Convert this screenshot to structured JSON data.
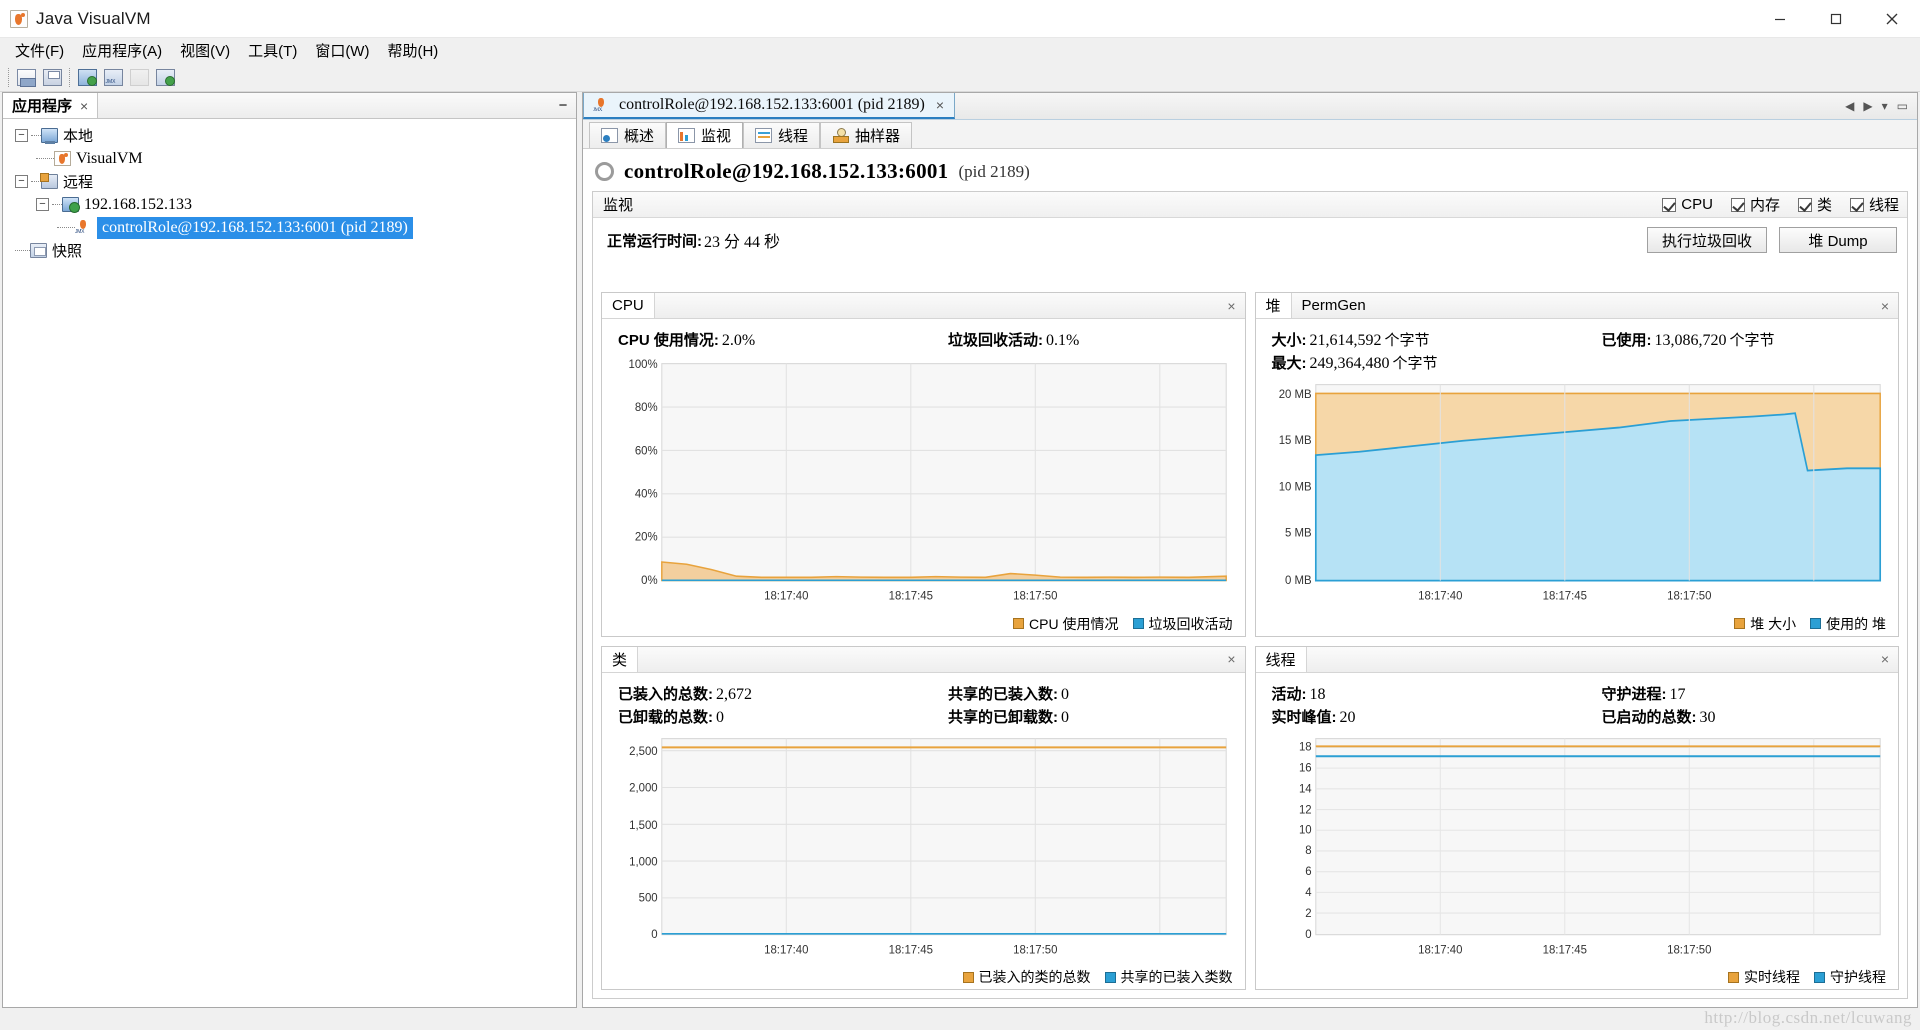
{
  "window": {
    "title": "Java VisualVM",
    "icon": "visualvm-icon",
    "minimize": "minimize-icon",
    "maximize": "maximize-icon",
    "close": "close-icon"
  },
  "menubar": [
    {
      "label": "文件(F)"
    },
    {
      "label": "应用程序(A)"
    },
    {
      "label": "视图(V)"
    },
    {
      "label": "工具(T)"
    },
    {
      "label": "窗口(W)"
    },
    {
      "label": "帮助(H)"
    }
  ],
  "toolbar": {
    "buttons": [
      {
        "name": "open-snapshot-icon"
      },
      {
        "name": "save-icon"
      },
      {
        "name": "add-remote-host-icon"
      },
      {
        "name": "add-jmx-connection-icon"
      },
      {
        "name": "application-disabled-icon"
      },
      {
        "name": "take-snapshot-icon"
      }
    ]
  },
  "sidebar": {
    "tab_label": "应用程序",
    "tab_close": "×",
    "minimize": "−",
    "tree": [
      {
        "label": "本地",
        "icon": "computer-icon",
        "expanded": true,
        "level": 0,
        "selected": false
      },
      {
        "label": "VisualVM",
        "icon": "visualvm-icon",
        "level": 1,
        "selected": false
      },
      {
        "label": "远程",
        "icon": "remote-icon",
        "expanded": true,
        "level": 0,
        "selected": false
      },
      {
        "label": "192.168.152.133",
        "icon": "remote-host-icon",
        "expanded": true,
        "level": 1,
        "selected": false
      },
      {
        "label": "controlRole@192.168.152.133:6001 (pid 2189)",
        "icon": "jmx-connection-icon",
        "level": 2,
        "selected": true
      },
      {
        "label": "快照",
        "icon": "snapshots-icon",
        "level": 0,
        "selected": false
      }
    ]
  },
  "document": {
    "tab_label": "controlRole@192.168.152.133:6001 (pid 2189)",
    "tab_close": "×",
    "subtabs": [
      {
        "label": "概述",
        "icon": "overview-icon",
        "active": false
      },
      {
        "label": "监视",
        "icon": "monitor-icon",
        "active": true
      },
      {
        "label": "线程",
        "icon": "threads-icon",
        "active": false
      },
      {
        "label": "抽样器",
        "icon": "sampler-icon",
        "active": false
      }
    ],
    "header_title": "controlRole@192.168.152.133:6001",
    "header_pid": "(pid 2189)"
  },
  "monitor": {
    "section_title": "监视",
    "checkboxes": [
      {
        "label": "CPU",
        "checked": true
      },
      {
        "label": "内存",
        "checked": true
      },
      {
        "label": "类",
        "checked": true
      },
      {
        "label": "线程",
        "checked": true
      }
    ],
    "uptime_label": "正常运行时间:",
    "uptime_value": "23 分 44 秒",
    "buttons": [
      {
        "label": "执行垃圾回收"
      },
      {
        "label": "堆 Dump"
      }
    ]
  },
  "panels": {
    "cpu": {
      "title": "CPU",
      "close": "×",
      "stats": [
        {
          "label": "CPU 使用情况:",
          "value": "2.0%"
        },
        {
          "label": "垃圾回收活动:",
          "value": "0.1%"
        }
      ],
      "legend": [
        {
          "label": "CPU 使用情况",
          "color": "#e8a33d"
        },
        {
          "label": "垃圾回收活动",
          "color": "#2b9fd4"
        }
      ]
    },
    "heap": {
      "title": "堆",
      "title2": "PermGen",
      "close": "×",
      "stats": [
        {
          "label": "大小:",
          "value": "21,614,592",
          "unit": "个字节"
        },
        {
          "label": "已使用:",
          "value": "13,086,720",
          "unit": "个字节"
        },
        {
          "label": "最大:",
          "value": "249,364,480",
          "unit": "个字节"
        }
      ],
      "legend": [
        {
          "label": "堆 大小",
          "color": "#e8a33d"
        },
        {
          "label": "使用的 堆",
          "color": "#2b9fd4"
        }
      ]
    },
    "classes": {
      "title": "类",
      "close": "×",
      "stats": [
        {
          "label": "已装入的总数:",
          "value": "2,672"
        },
        {
          "label": "共享的已装入数:",
          "value": "0"
        },
        {
          "label": "已卸载的总数:",
          "value": "0"
        },
        {
          "label": "共享的已卸载数:",
          "value": "0"
        }
      ],
      "legend": [
        {
          "label": "已装入的类的总数",
          "color": "#e8a33d"
        },
        {
          "label": "共享的已装入类数",
          "color": "#2b9fd4"
        }
      ]
    },
    "threads": {
      "title": "线程",
      "close": "×",
      "stats": [
        {
          "label": "活动:",
          "value": "18"
        },
        {
          "label": "守护进程:",
          "value": "17"
        },
        {
          "label": "实时峰值:",
          "value": "20"
        },
        {
          "label": "已启动的总数:",
          "value": "30"
        }
      ],
      "legend": [
        {
          "label": "实时线程",
          "color": "#e8a33d"
        },
        {
          "label": "守护线程",
          "color": "#2b9fd4"
        }
      ]
    }
  },
  "chart_data": [
    {
      "type": "area",
      "id": "cpu-chart",
      "title": "CPU",
      "xlabel": "",
      "ylabel": "",
      "ytick_labels": [
        "0%",
        "20%",
        "40%",
        "60%",
        "80%",
        "100%"
      ],
      "ylim": [
        0,
        100
      ],
      "xtick_labels": [
        "18:17:40",
        "18:17:45",
        "18:17:50"
      ],
      "x": [
        0,
        2,
        4,
        6,
        8,
        10,
        12,
        14,
        16,
        18,
        20,
        22,
        24,
        26,
        28,
        30,
        32,
        34,
        36,
        38,
        40,
        42,
        44
      ],
      "series": [
        {
          "name": "CPU 使用情况",
          "color": "#e8a33d",
          "values": [
            8.5,
            7.5,
            5.0,
            2.0,
            1.5,
            1.5,
            1.5,
            1.8,
            1.6,
            1.5,
            1.5,
            1.8,
            1.6,
            1.5,
            3.2,
            2.5,
            1.6,
            1.5,
            1.6,
            1.5,
            1.6,
            1.5,
            2.0
          ]
        },
        {
          "name": "垃圾回收活动",
          "color": "#2b9fd4",
          "values": [
            0.1,
            0.1,
            0.1,
            0.1,
            0.1,
            0.1,
            0.1,
            0.1,
            0.1,
            0.1,
            0.1,
            0.1,
            0.1,
            0.1,
            0.1,
            0.1,
            0.1,
            0.1,
            0.1,
            0.1,
            0.1,
            0.1,
            0.1
          ]
        }
      ],
      "grid": true,
      "legend_position": "bottom-right"
    },
    {
      "type": "area",
      "id": "heap-chart",
      "title": "堆",
      "ytick_labels": [
        "0 MB",
        "5 MB",
        "10 MB",
        "15 MB",
        "20 MB"
      ],
      "ylim": [
        0,
        22
      ],
      "xtick_labels": [
        "18:17:40",
        "18:17:45",
        "18:17:50"
      ],
      "x": [
        0,
        4,
        8,
        12,
        16,
        20,
        24,
        28,
        32,
        36,
        38,
        40,
        42,
        44
      ],
      "series": [
        {
          "name": "堆 大小",
          "color": "#e8a33d",
          "values": [
            20.6,
            20.6,
            20.6,
            20.6,
            20.6,
            20.6,
            20.6,
            20.6,
            20.6,
            20.6,
            20.6,
            20.6,
            20.6,
            20.6
          ]
        },
        {
          "name": "使用的 堆",
          "color": "#2b9fd4",
          "values": [
            14.0,
            14.3,
            14.8,
            15.2,
            15.6,
            16.0,
            16.3,
            16.9,
            17.0,
            17.1,
            17.4,
            17.5,
            12.4,
            12.5
          ]
        }
      ],
      "grid": true,
      "legend_position": "bottom-right"
    },
    {
      "type": "line",
      "id": "classes-chart",
      "title": "类",
      "ytick_labels": [
        "0",
        "500",
        "1,000",
        "1,500",
        "2,000",
        "2,500"
      ],
      "ylim": [
        0,
        2800
      ],
      "xtick_labels": [
        "18:17:40",
        "18:17:45",
        "18:17:50"
      ],
      "x": [
        0,
        10,
        20,
        30,
        44
      ],
      "series": [
        {
          "name": "已装入的类的总数",
          "color": "#e8a33d",
          "values": [
            2672,
            2672,
            2672,
            2672,
            2672
          ]
        },
        {
          "name": "共享的已装入类数",
          "color": "#2b9fd4",
          "values": [
            0,
            0,
            0,
            0,
            0
          ]
        }
      ],
      "grid": true,
      "legend_position": "bottom-right"
    },
    {
      "type": "line",
      "id": "threads-chart",
      "title": "线程",
      "ytick_labels": [
        "0",
        "2",
        "4",
        "6",
        "8",
        "10",
        "12",
        "14",
        "16",
        "18"
      ],
      "ylim": [
        0,
        19
      ],
      "xtick_labels": [
        "18:17:40",
        "18:17:45",
        "18:17:50"
      ],
      "x": [
        0,
        10,
        20,
        30,
        44
      ],
      "series": [
        {
          "name": "实时线程",
          "color": "#e8a33d",
          "values": [
            18,
            18,
            18,
            18,
            18
          ]
        },
        {
          "name": "守护线程",
          "color": "#2b9fd4",
          "values": [
            17,
            17,
            17,
            17,
            17
          ]
        }
      ],
      "grid": true,
      "legend_position": "bottom-right"
    }
  ],
  "watermark": "http://blog.csdn.net/lcuwang"
}
